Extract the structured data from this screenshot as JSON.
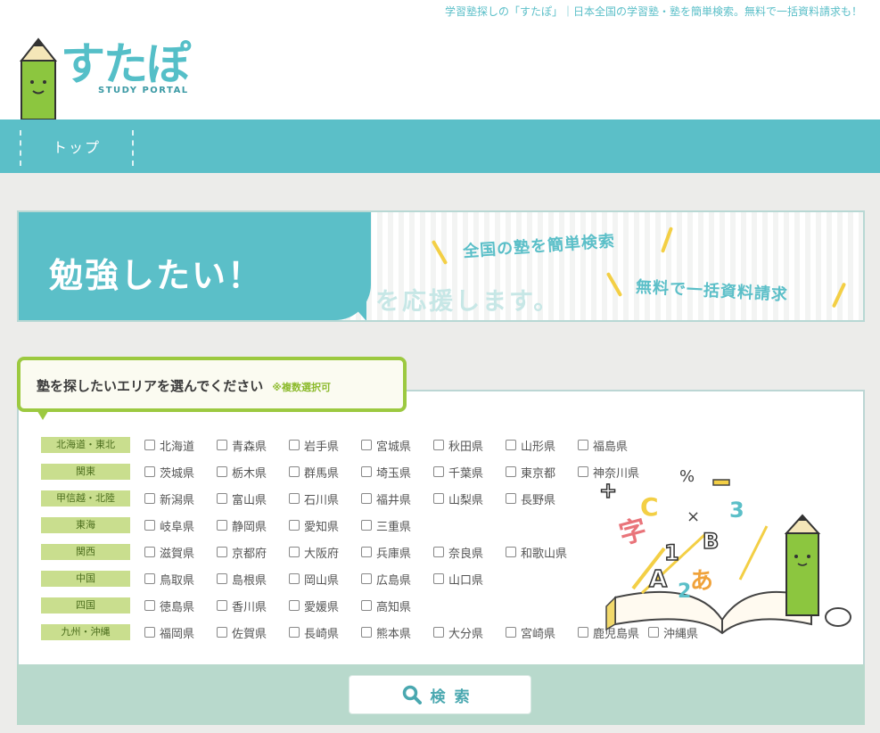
{
  "header": {
    "tagline": "学習塾探しの「すたぽ」｜日本全国の学習塾・塾を簡単検索。無料で一括資料請求も！",
    "logo_text": "すたぽ",
    "logo_sub": "STUDY PORTAL"
  },
  "nav": {
    "items": [
      {
        "label": "トップ"
      }
    ]
  },
  "banner": {
    "title": "勉強したい！",
    "subtitle": "を応援します。",
    "point1": "全国の塾を簡単検索",
    "point2": "無料で一括資料請求"
  },
  "area": {
    "heading": "塾を探したいエリアを選んでください",
    "note": "※複数選択可",
    "regions": [
      {
        "name": "北海道・東北",
        "prefs": [
          "北海道",
          "青森県",
          "岩手県",
          "宮城県",
          "秋田県",
          "山形県",
          "福島県"
        ]
      },
      {
        "name": "関東",
        "prefs": [
          "茨城県",
          "栃木県",
          "群馬県",
          "埼玉県",
          "千葉県",
          "東京都",
          "神奈川県"
        ]
      },
      {
        "name": "甲信越・北陸",
        "prefs": [
          "新潟県",
          "富山県",
          "石川県",
          "福井県",
          "山梨県",
          "長野県"
        ]
      },
      {
        "name": "東海",
        "prefs": [
          "岐阜県",
          "静岡県",
          "愛知県",
          "三重県"
        ]
      },
      {
        "name": "関西",
        "prefs": [
          "滋賀県",
          "京都府",
          "大阪府",
          "兵庫県",
          "奈良県",
          "和歌山県"
        ]
      },
      {
        "name": "中国",
        "prefs": [
          "鳥取県",
          "島根県",
          "岡山県",
          "広島県",
          "山口県"
        ]
      },
      {
        "name": "四国",
        "prefs": [
          "徳島県",
          "香川県",
          "愛媛県",
          "高知県"
        ]
      },
      {
        "name": "九州・沖縄",
        "prefs": [
          "福岡県",
          "佐賀県",
          "長崎県",
          "熊本県",
          "大分県",
          "宮崎県",
          "鹿児島県",
          "沖縄県"
        ]
      }
    ]
  },
  "search": {
    "label": "検索"
  },
  "colors": {
    "accent": "#5bbfc8",
    "green": "#9cc940",
    "tag": "#c9de8e"
  }
}
